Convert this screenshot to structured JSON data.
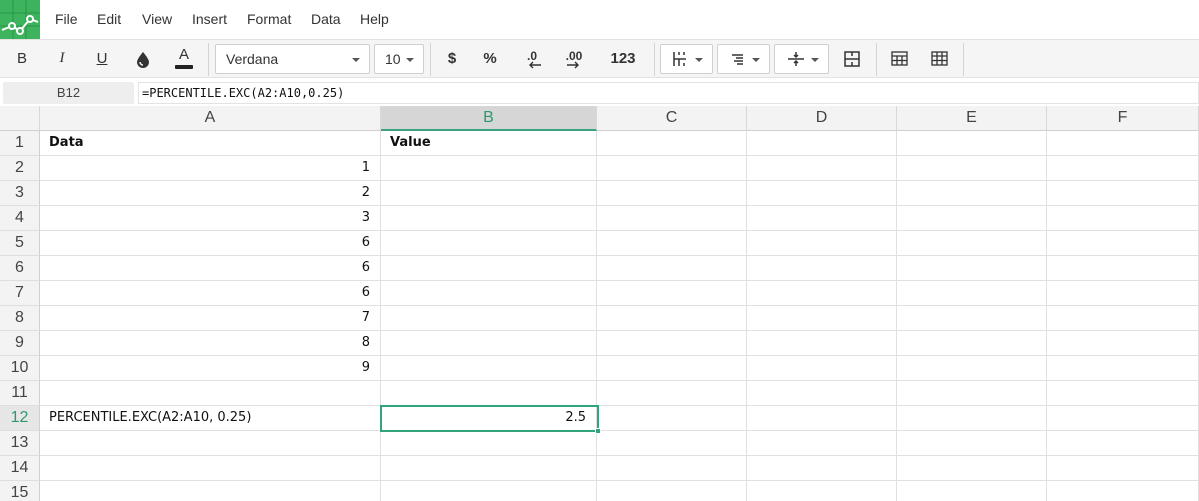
{
  "menu": [
    "File",
    "Edit",
    "View",
    "Insert",
    "Format",
    "Data",
    "Help"
  ],
  "toolbar": {
    "bold": "B",
    "italic": "I",
    "underline": "U",
    "text_color_glyph": "A",
    "font": "Verdana",
    "font_size": "10",
    "currency": "$",
    "percent": "%",
    "dec_decrease": ".0",
    "dec_increase": ".00",
    "number_format": "123"
  },
  "formula_bar": {
    "cell_ref": "B12",
    "formula": "=PERCENTILE.EXC(A2:A10,0.25)"
  },
  "grid": {
    "columns": [
      "A",
      "B",
      "C",
      "D",
      "E",
      "F"
    ],
    "selected_column": "B",
    "selected_row": 12,
    "rows": [
      {
        "num": "1",
        "a": "Data",
        "b": "Value"
      },
      {
        "num": "2",
        "a": "1",
        "b": ""
      },
      {
        "num": "3",
        "a": "2",
        "b": ""
      },
      {
        "num": "4",
        "a": "3",
        "b": ""
      },
      {
        "num": "5",
        "a": "6",
        "b": ""
      },
      {
        "num": "6",
        "a": "6",
        "b": ""
      },
      {
        "num": "7",
        "a": "6",
        "b": ""
      },
      {
        "num": "8",
        "a": "7",
        "b": ""
      },
      {
        "num": "9",
        "a": "8",
        "b": ""
      },
      {
        "num": "10",
        "a": "9",
        "b": ""
      },
      {
        "num": "11",
        "a": "",
        "b": ""
      },
      {
        "num": "12",
        "a": "PERCENTILE.EXC(A2:A10, 0.25)",
        "b": "2.5"
      },
      {
        "num": "13",
        "a": "",
        "b": ""
      },
      {
        "num": "14",
        "a": "",
        "b": ""
      },
      {
        "num": "15",
        "a": "",
        "b": ""
      }
    ]
  },
  "colors": {
    "brand": "#3cb35c",
    "selection": "#33a37a"
  }
}
